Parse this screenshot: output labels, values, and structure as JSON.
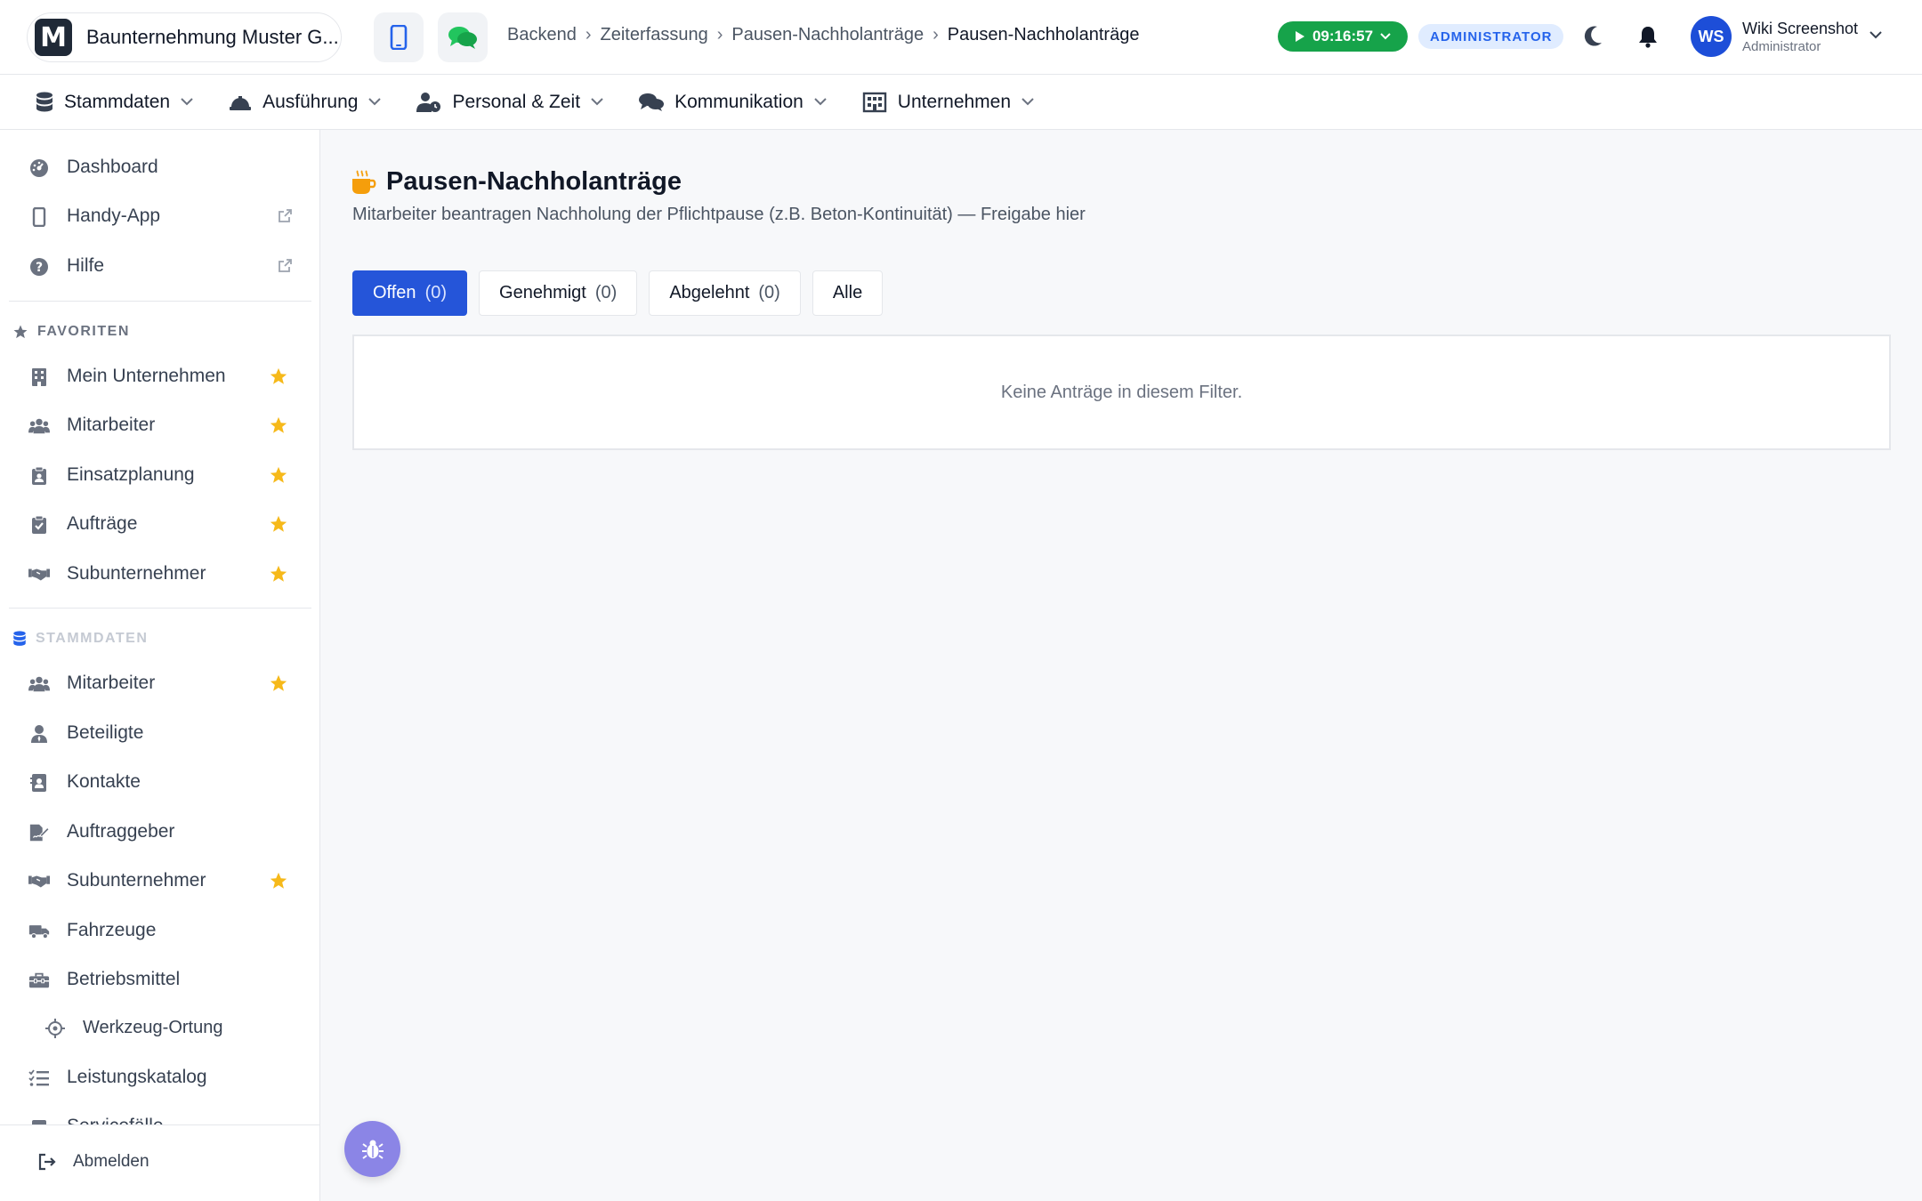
{
  "header": {
    "company_logo_letter": "M",
    "company_name": "Baunternehmung Muster G...",
    "breadcrumb": [
      "Backend",
      "Zeiterfassung",
      "Pausen-Nachholanträge",
      "Pausen-Nachholanträge"
    ],
    "timer": "09:16:57",
    "role_badge": "ADMINISTRATOR",
    "user": {
      "initials": "WS",
      "name": "Wiki Screenshot",
      "role": "Administrator"
    }
  },
  "nav": [
    {
      "label": "Stammdaten",
      "icon": "database-icon"
    },
    {
      "label": "Ausführung",
      "icon": "hard-hat-icon"
    },
    {
      "label": "Personal & Zeit",
      "icon": "user-clock-icon"
    },
    {
      "label": "Kommunikation",
      "icon": "comments-icon"
    },
    {
      "label": "Unternehmen",
      "icon": "building-icon"
    }
  ],
  "sidebar": {
    "top": [
      {
        "label": "Dashboard"
      },
      {
        "label": "Handy-App"
      },
      {
        "label": "Hilfe"
      }
    ],
    "favorites_title": "FAVORITEN",
    "favorites": [
      {
        "label": "Mein Unternehmen"
      },
      {
        "label": "Mitarbeiter"
      },
      {
        "label": "Einsatzplanung"
      },
      {
        "label": "Aufträge"
      },
      {
        "label": "Subunternehmer"
      }
    ],
    "stammdaten_title": "STAMMDATEN",
    "stammdaten": [
      {
        "label": "Mitarbeiter"
      },
      {
        "label": "Beteiligte"
      },
      {
        "label": "Kontakte"
      },
      {
        "label": "Auftraggeber"
      },
      {
        "label": "Subunternehmer"
      },
      {
        "label": "Fahrzeuge"
      },
      {
        "label": "Betriebsmittel"
      },
      {
        "label": "Werkzeug-Ortung"
      },
      {
        "label": "Leistungskatalog"
      },
      {
        "label": "Servicefälle"
      }
    ],
    "logout": "Abmelden"
  },
  "page": {
    "title": "Pausen-Nachholanträge",
    "subtitle": "Mitarbeiter beantragen Nachholung der Pflichtpause (z.B. Beton-Kontinuität) — Freigabe hier",
    "tabs": [
      {
        "label": "Offen",
        "count": "(0)"
      },
      {
        "label": "Genehmigt",
        "count": "(0)"
      },
      {
        "label": "Abgelehnt",
        "count": "(0)"
      },
      {
        "label": "Alle",
        "count": ""
      }
    ],
    "empty_message": "Keine Anträge in diesem Filter."
  },
  "colors": {
    "accent": "#2555d9",
    "timer_green": "#16a34a",
    "star_yellow": "#f6b91a",
    "title_icon_orange": "#f59e0b",
    "fab_purple": "#8b85e6"
  }
}
